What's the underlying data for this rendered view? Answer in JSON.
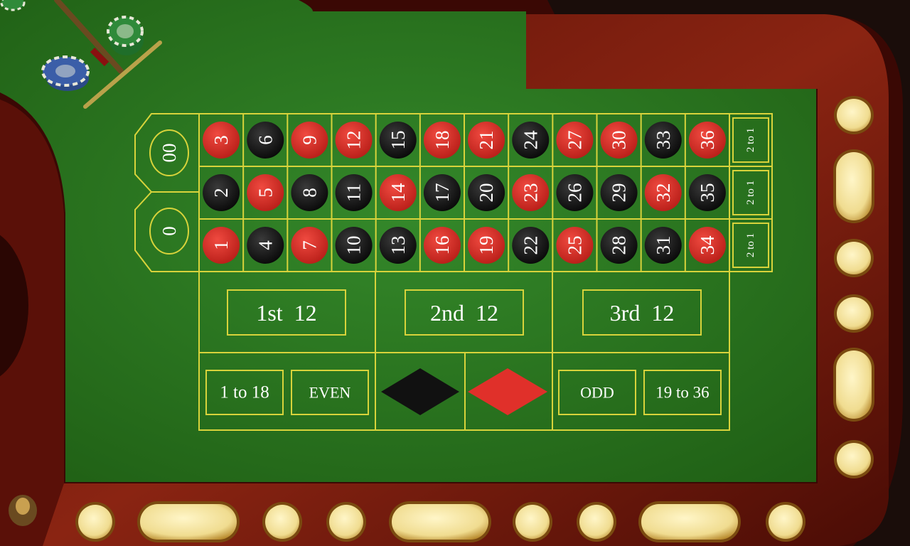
{
  "colors": {
    "felt": "#2e7d1c",
    "felt_dark": "#1f5e14",
    "line": "#d8d33b",
    "red": "#d9302a",
    "black": "#161616",
    "wood": "#7a1a0c",
    "button": "#f2e3a0"
  },
  "zeros": [
    {
      "label": "00"
    },
    {
      "label": "0"
    }
  ],
  "grid": {
    "rows": [
      [
        {
          "n": "3",
          "c": "red"
        },
        {
          "n": "6",
          "c": "black"
        },
        {
          "n": "9",
          "c": "red"
        },
        {
          "n": "12",
          "c": "red"
        },
        {
          "n": "15",
          "c": "black"
        },
        {
          "n": "18",
          "c": "red"
        },
        {
          "n": "21",
          "c": "red"
        },
        {
          "n": "24",
          "c": "black"
        },
        {
          "n": "27",
          "c": "red"
        },
        {
          "n": "30",
          "c": "red"
        },
        {
          "n": "33",
          "c": "black"
        },
        {
          "n": "36",
          "c": "red"
        }
      ],
      [
        {
          "n": "2",
          "c": "black"
        },
        {
          "n": "5",
          "c": "red"
        },
        {
          "n": "8",
          "c": "black"
        },
        {
          "n": "11",
          "c": "black"
        },
        {
          "n": "14",
          "c": "red"
        },
        {
          "n": "17",
          "c": "black"
        },
        {
          "n": "20",
          "c": "black"
        },
        {
          "n": "23",
          "c": "red"
        },
        {
          "n": "26",
          "c": "black"
        },
        {
          "n": "29",
          "c": "black"
        },
        {
          "n": "32",
          "c": "red"
        },
        {
          "n": "35",
          "c": "black"
        }
      ],
      [
        {
          "n": "1",
          "c": "red"
        },
        {
          "n": "4",
          "c": "black"
        },
        {
          "n": "7",
          "c": "red"
        },
        {
          "n": "10",
          "c": "black"
        },
        {
          "n": "13",
          "c": "black"
        },
        {
          "n": "16",
          "c": "red"
        },
        {
          "n": "19",
          "c": "red"
        },
        {
          "n": "22",
          "c": "black"
        },
        {
          "n": "25",
          "c": "red"
        },
        {
          "n": "28",
          "c": "black"
        },
        {
          "n": "31",
          "c": "black"
        },
        {
          "n": "34",
          "c": "red"
        }
      ]
    ],
    "column_bets": [
      "2 to 1",
      "2 to 1",
      "2 to 1"
    ]
  },
  "dozens": [
    "1st  12",
    "2nd  12",
    "3rd  12"
  ],
  "outside": {
    "low": "1 to 18",
    "even": "EVEN",
    "black": "black",
    "red": "red",
    "odd": "ODD",
    "high": "19 to 36"
  },
  "chips": [
    {
      "name": "green-chip-stack",
      "color": "#2f8a3a"
    },
    {
      "name": "blue-chip-stack",
      "color": "#3b5ea8"
    }
  ],
  "right_buttons": [
    "round",
    "pill",
    "round",
    "round",
    "pill",
    "round"
  ],
  "bottom_buttons": [
    "round",
    "pill",
    "round",
    "round",
    "pill",
    "round",
    "round",
    "pill",
    "round"
  ]
}
